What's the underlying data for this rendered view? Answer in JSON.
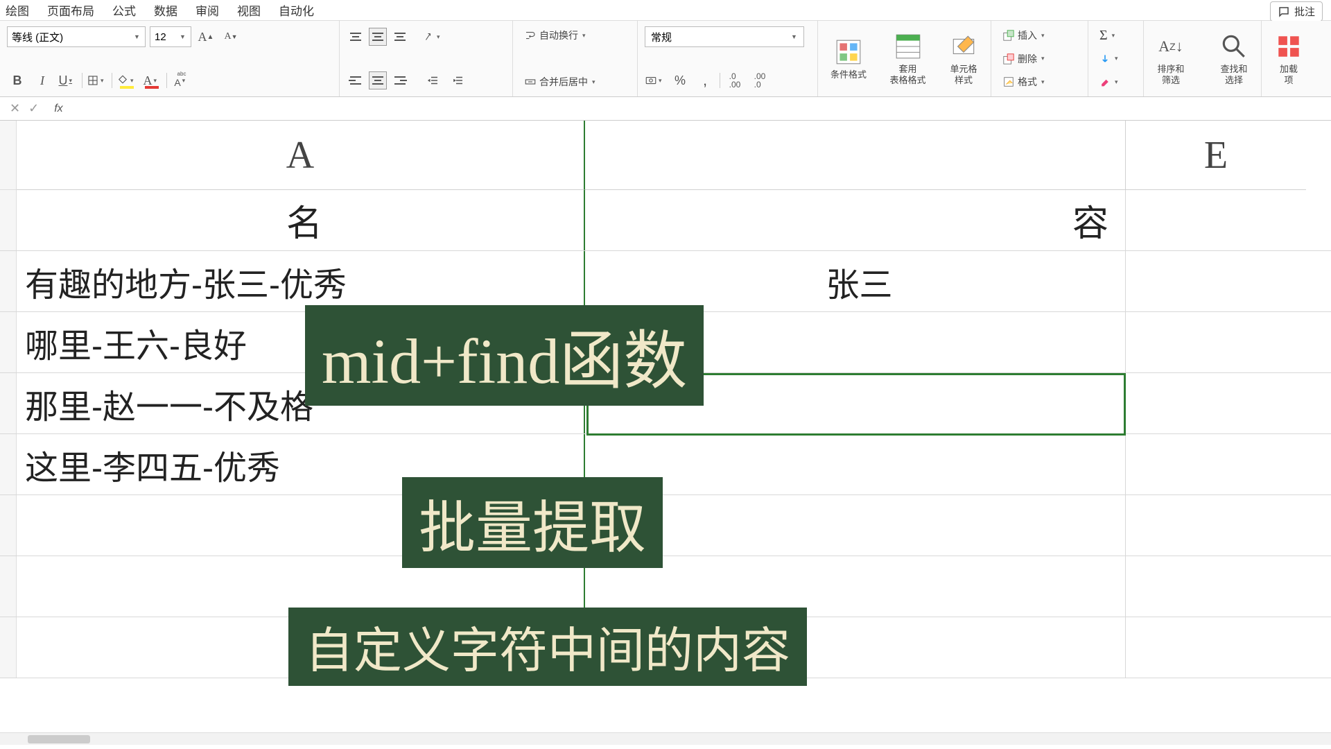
{
  "menu": [
    "绘图",
    "页面布局",
    "公式",
    "数据",
    "审阅",
    "视图",
    "自动化"
  ],
  "comment_btn": "批注",
  "font": {
    "name": "等线 (正文)",
    "size": "12"
  },
  "number_format": "常规",
  "wrap_label": "自动换行",
  "merge_label": "合并后居中",
  "cond_fmt": "条件格式",
  "table_fmt": "套用\n表格格式",
  "cell_style": "单元格\n样式",
  "insert": "插入",
  "delete": "删除",
  "format": "格式",
  "sort": "排序和\n筛选",
  "find": "查找和\n选择",
  "addin": "加载\n项",
  "cols": {
    "A": "A",
    "E": "E"
  },
  "rows": {
    "header": {
      "a": "名",
      "b": "容"
    },
    "r1": {
      "a": "有趣的地方-张三-优秀",
      "b": "张三"
    },
    "r2": {
      "a": "哪里-王六-良好",
      "b": ""
    },
    "r3": {
      "a": "那里-赵一一-不及格",
      "b": ""
    },
    "r4": {
      "a": "这里-李四五-优秀",
      "b": ""
    }
  },
  "overlay": {
    "l1": "mid+find函数",
    "l2": "批量提取",
    "l3": "自定义字符中间的内容"
  }
}
